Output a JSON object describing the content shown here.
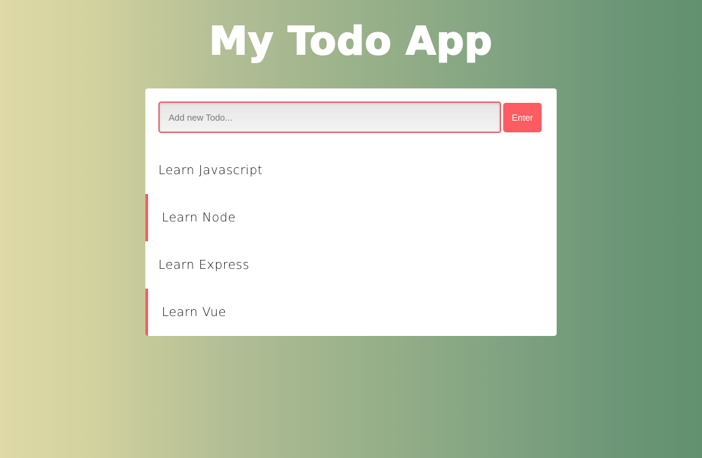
{
  "app": {
    "title": "My Todo App"
  },
  "form": {
    "input_value": "",
    "input_placeholder": "Add new Todo...",
    "submit_label": "Enter"
  },
  "todos": [
    {
      "text": "Learn Javascript",
      "highlighted": false
    },
    {
      "text": "Learn Node",
      "highlighted": true
    },
    {
      "text": "Learn Express",
      "highlighted": false
    },
    {
      "text": "Learn Vue",
      "highlighted": true
    }
  ],
  "colors": {
    "accent": "#fd5c63",
    "card": "#ffffff",
    "gradient_start": "#ded9a7",
    "gradient_end": "#62916f"
  }
}
